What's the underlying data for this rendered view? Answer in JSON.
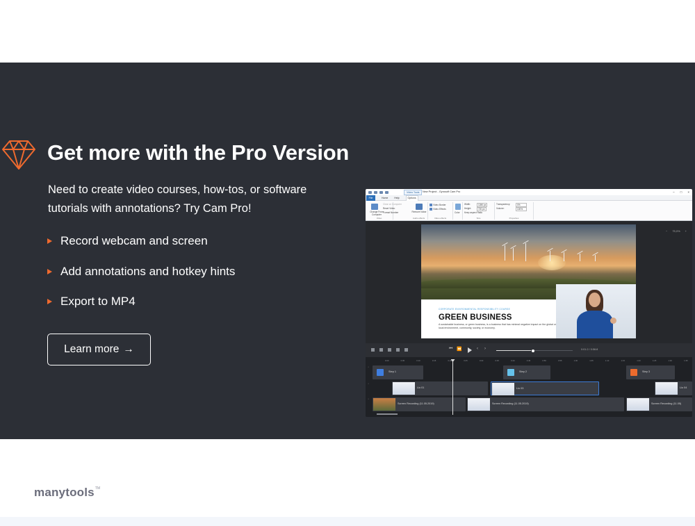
{
  "promo": {
    "title": "Get more with the Pro Version",
    "intro": "Need to create video courses, how-tos, or software tutorials with annotations? Try Cam Pro!",
    "features": [
      "Record webcam and screen",
      "Add annotations and hotkey hints",
      "Export to MP4"
    ],
    "cta_label": "Learn more",
    "cta_arrow": "→",
    "icon": "diamond-icon",
    "accent_color": "#ef6a2e",
    "background_color": "#2c2f36"
  },
  "screenshot": {
    "window_title": "New Project - Gyrosoft Cam Pro",
    "tools_tab": "Video Tools",
    "file_tab": "File",
    "ribbon_tabs": [
      "Home",
      "Help",
      "Options"
    ],
    "ribbon": {
      "change_from_computer": "Change From Computer",
      "clear_on_computer": "Clear on Computer",
      "reset_video": "Reset Video",
      "format_number": "Format Number",
      "remove_noise": "Remove Noise",
      "video_border": "Video Border",
      "video_effects": "Video Effects",
      "color": "Color",
      "width_label": "Width:",
      "width_value": "1280 px",
      "height_label": "Height:",
      "height_value": "720 px",
      "keep_aspect": "Keep aspect Ratio",
      "transparency_label": "Transparency:",
      "transparency_value": "0%",
      "volume_label": "Volume:",
      "volume_value": "100%",
      "group_video": "Video",
      "group_audio": "Audio effects",
      "group_video_effects": "Video effects",
      "group_size": "Size",
      "group_properties": "Properties"
    },
    "zoom": {
      "minus": "−",
      "value": "75,0%",
      "plus": "+"
    },
    "slide": {
      "overline": "CORPORATE ENVIRONMENTAL RESPONSIBILITY COURSE",
      "title": "GREEN BUSINESS",
      "body": "A sustainable business, or green business, is a business that has minimal negative impact on the global or local environment, community, society, or economy."
    },
    "timecode": "0:01:2 / 0:56:8",
    "progress_fraction": 0.45,
    "ruler_ticks": [
      "0:00",
      "0:05",
      "0:10",
      "0:15",
      "0:20",
      "0:25",
      "0:30",
      "0:35",
      "0:40",
      "0:45",
      "0:50",
      "0:55",
      "1:00",
      "1:05",
      "1:10",
      "1:15",
      "1:20",
      "1:25",
      "1:30",
      "1:35"
    ],
    "step_clips": [
      {
        "label": "Step 1",
        "color": "#3f7ee0"
      },
      {
        "label": "Step 2",
        "color": "#65c1ea"
      },
      {
        "label": "Step 3",
        "color": "#ec6b2d"
      }
    ],
    "video_clips": [
      "Lio 01",
      "Lio 03",
      "Lio 04"
    ],
    "recording_clips": [
      "Screen Recording (11.05.2019)",
      "Screen Recording (11.05.2019)",
      "Screen Recording (11.05)"
    ]
  },
  "footer": {
    "logo_text": "manytools",
    "logo_tm": "TM"
  }
}
